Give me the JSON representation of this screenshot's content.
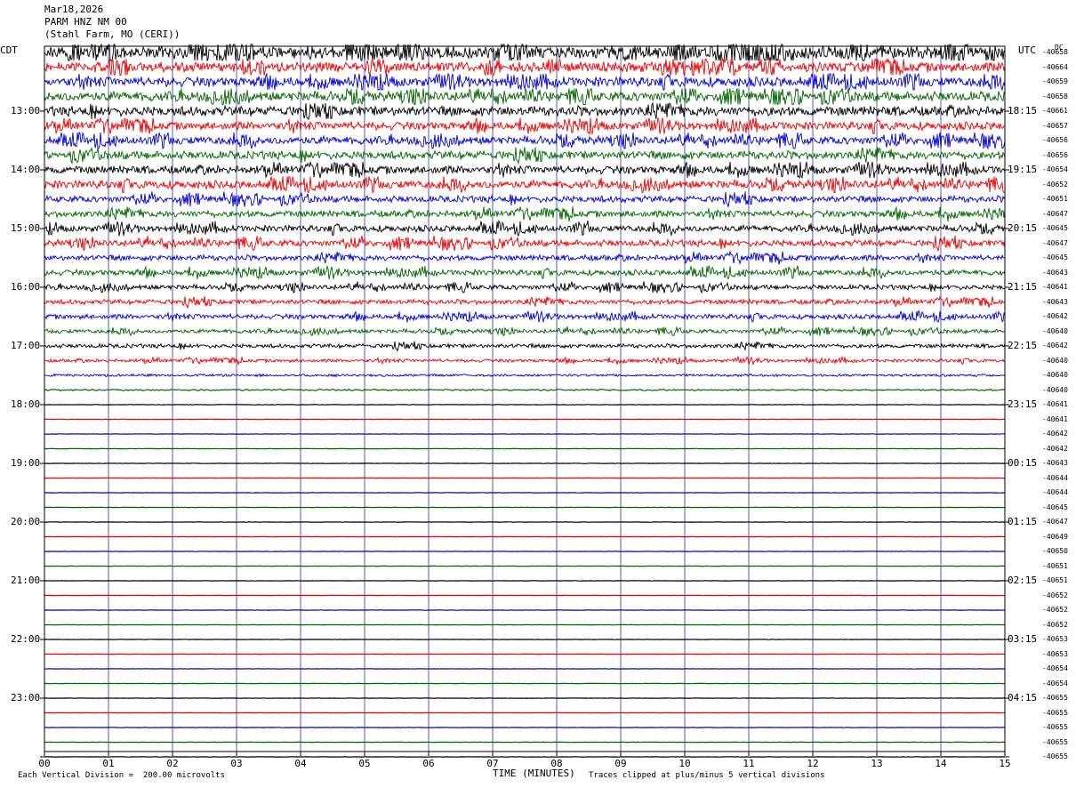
{
  "header": {
    "date": "Mar18,2026",
    "station": "PARM HNZ NM 00",
    "location": "(Stahl Farm, MO (CERI))"
  },
  "labels": {
    "left_tz": "CDT",
    "right_tz": "UTC",
    "dc_header": "DC",
    "x_title": "TIME (MINUTES)",
    "scale_note": "Each Vertical Division =  200.00 microvolts",
    "clip_note": "Traces clipped at plus/minus 5 vertical divisions"
  },
  "colors": {
    "trace_cycle": [
      "#000000",
      "#ee0000",
      "#0000dd",
      "#006600"
    ],
    "grid": "#3333aa",
    "frame": "#000000"
  },
  "chart_data": {
    "type": "line",
    "title": "PARM HNZ NM 00",
    "xlabel": "TIME (MINUTES)",
    "x_ticks": [
      "00",
      "01",
      "02",
      "03",
      "04",
      "05",
      "06",
      "07",
      "08",
      "09",
      "10",
      "11",
      "12",
      "13",
      "14",
      "15"
    ],
    "xlim": [
      0,
      15
    ],
    "left_time_labels": [
      "13:00",
      "14:00",
      "15:00",
      "16:00",
      "17:00",
      "18:00",
      "19:00",
      "20:00",
      "21:00",
      "22:00",
      "23:00"
    ],
    "right_time_labels": [
      "18:15",
      "19:15",
      "20:15",
      "21:15",
      "22:15",
      "23:15",
      "00:15",
      "01:15",
      "02:15",
      "03:15",
      "04:15"
    ],
    "dc_offsets": [
      "-40658",
      "-40664",
      "-40659",
      "-40658",
      "-40661",
      "-40657",
      "-40656",
      "-40656",
      "-40654",
      "-40652",
      "-40651",
      "-40647",
      "-40645",
      "-40647",
      "-40645",
      "-40643",
      "-40641",
      "-40643",
      "-40642",
      "-40640",
      "-40642",
      "-40640",
      "-40640",
      "-40640",
      "-40641",
      "-40641",
      "-40642",
      "-40642",
      "-40643",
      "-40644",
      "-40644",
      "-40645",
      "-40647",
      "-40649",
      "-40650",
      "-40651",
      "-40651",
      "-40652",
      "-40652",
      "-40652",
      "-40653",
      "-40653",
      "-40654",
      "-40654",
      "-40655",
      "-40655",
      "-40655",
      "-40655",
      "-40655"
    ],
    "activity": [
      8,
      6,
      6,
      6,
      6,
      5,
      5,
      5,
      5,
      5,
      4,
      4,
      4,
      4,
      3.5,
      3.5,
      3,
      3,
      3,
      2.5,
      2.5,
      2,
      1.5,
      1,
      0.3,
      0.3,
      0.25,
      0.25,
      0.25,
      0.25,
      0.2,
      0.2,
      0.2,
      0.2,
      0.2,
      0.2,
      0.2,
      0.2,
      0.2,
      0.2,
      0.2,
      0.2,
      0.2,
      0.2,
      0.2,
      0.2,
      0.2,
      0.2,
      0.2
    ],
    "grid": true
  }
}
